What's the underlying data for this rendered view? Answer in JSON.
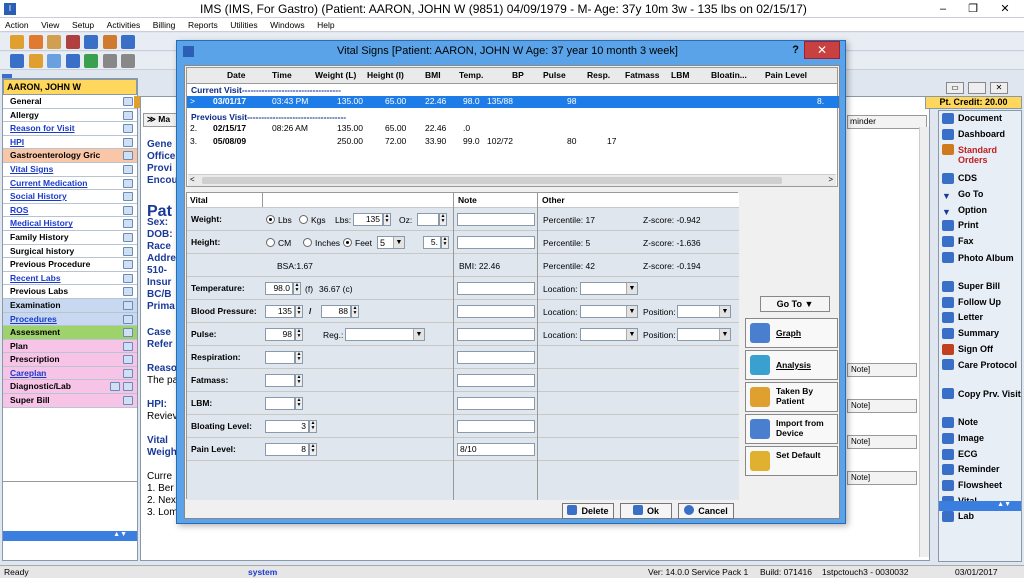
{
  "app": {
    "title": "IMS (IMS, For Gastro)    (Patient: AARON, JOHN W (9851) 04/09/1979 - M- Age: 37y 10m 3w - 135 lbs on 02/15/17)",
    "min": "–",
    "restore": "❐",
    "close": "✕"
  },
  "menu": [
    "Action",
    "View",
    "Setup",
    "Activities",
    "Billing",
    "Reports",
    "Utilities",
    "Windows",
    "Help"
  ],
  "patient_name": "AARON, JOHN W",
  "pt_credit": "Pt. Credit: 20.00",
  "left_nav": [
    {
      "label": "General",
      "bg": "#ffffff"
    },
    {
      "label": "Allergy",
      "bg": "#ffffff"
    },
    {
      "label": "Reason for Visit",
      "bg": "#ffffff",
      "fg": "#1a3acc"
    },
    {
      "label": "HPI",
      "bg": "#ffffff",
      "fg": "#1a3acc"
    },
    {
      "label": "Gastroenterology Gric",
      "bg": "#f9c7a8"
    },
    {
      "label": "Vital Signs",
      "bg": "#ffffff",
      "fg": "#1a3acc"
    },
    {
      "label": "Current Medication",
      "bg": "#ffffff",
      "fg": "#1a3acc"
    },
    {
      "label": "Social History",
      "bg": "#ffffff",
      "fg": "#1a3acc"
    },
    {
      "label": "ROS",
      "bg": "#ffffff",
      "fg": "#1a3acc"
    },
    {
      "label": "Medical History",
      "bg": "#ffffff",
      "fg": "#1a3acc"
    },
    {
      "label": "Family History",
      "bg": "#ffffff"
    },
    {
      "label": "Surgical history",
      "bg": "#ffffff"
    },
    {
      "label": "Previous Procedure",
      "bg": "#ffffff"
    },
    {
      "label": "Recent Labs",
      "bg": "#ffffff",
      "fg": "#1a3acc"
    },
    {
      "label": "Previous Labs",
      "bg": "#ffffff"
    },
    {
      "label": "Examination",
      "bg": "#c7d8f0"
    },
    {
      "label": "Procedures",
      "bg": "#c7d8f0",
      "fg": "#1a3acc"
    },
    {
      "label": "Assessment",
      "bg": "#9ed36b"
    },
    {
      "label": "Plan",
      "bg": "#f7c4e8"
    },
    {
      "label": "Prescription",
      "bg": "#f7c4e8"
    },
    {
      "label": "Careplan",
      "bg": "#f7c4e8",
      "fg": "#1a3acc"
    },
    {
      "label": "Diagnostic/Lab",
      "bg": "#f7c4e8"
    },
    {
      "label": "Super Bill",
      "bg": "#f7c4e8"
    }
  ],
  "mid": {
    "tab_label": "Ma",
    "lines": [
      "Gene",
      "Office",
      "Provi",
      "Encou",
      "Pat",
      "Sex:",
      "DOB:",
      "Race",
      "Addre",
      "510-",
      "Insur",
      "BC/B",
      "Prima",
      "Case",
      "Refer",
      "Reaso",
      "The pa",
      "HPI:",
      "Reviev",
      "Vital",
      "Weigh",
      "Curre",
      "1. Ber",
      "2. Nex",
      "3. Lom"
    ],
    "reminder": "minder",
    "note_label": "Note]"
  },
  "right_panel": [
    {
      "label": "Document",
      "c": "#3a6fc8"
    },
    {
      "label": "Dashboard",
      "c": "#3a6fc8"
    },
    {
      "label": "Standard Orders",
      "c": "#d07a20",
      "red": true
    },
    {
      "label": "CDS",
      "c": "#3a6fc8"
    },
    {
      "label": "Go To",
      "c": "#1a3a9a",
      "arrow": true
    },
    {
      "label": "Option",
      "c": "#1a3a9a",
      "arrow": true
    },
    {
      "label": "Print",
      "c": "#3a6fc8"
    },
    {
      "label": "Fax",
      "c": "#3a6fc8"
    },
    {
      "label": "Photo Album",
      "c": "#3a6fc8"
    },
    {
      "label": "Super Bill",
      "c": "#3a6fc8"
    },
    {
      "label": "Follow Up",
      "c": "#3a6fc8"
    },
    {
      "label": "Letter",
      "c": "#3a6fc8"
    },
    {
      "label": "Summary",
      "c": "#3a6fc8"
    },
    {
      "label": "Sign Off",
      "c": "#c04020"
    },
    {
      "label": "Care Protocol",
      "c": "#3a6fc8"
    },
    {
      "label": "Copy Prv. Visit",
      "c": "#3a6fc8"
    },
    {
      "label": "Note",
      "c": "#3a6fc8"
    },
    {
      "label": "Image",
      "c": "#3a6fc8"
    },
    {
      "label": "ECG",
      "c": "#3a6fc8"
    },
    {
      "label": "Reminder",
      "c": "#3a6fc8"
    },
    {
      "label": "Flowsheet",
      "c": "#3a6fc8"
    },
    {
      "label": "Vital",
      "c": "#3a6fc8"
    },
    {
      "label": "Lab",
      "c": "#3a6fc8"
    }
  ],
  "dialog": {
    "title": "Vital Signs  [Patient: AARON, JOHN W  Age: 37 year 10 month 3 week]",
    "help": "?",
    "close": "✕",
    "grid_headers": [
      "Date",
      "Time",
      "Weight (L)",
      "Height (I)",
      "BMI",
      "Temp.",
      "BP",
      "Pulse",
      "Resp.",
      "Fatmass",
      "LBM",
      "Bloatin...",
      "Pain Level"
    ],
    "current_label": "Current Visit-----------------------------------",
    "previous_label": "Previous Visit-----------------------------------",
    "current_rows": [
      {
        "idx": ">",
        "date": "03/01/17",
        "time": "03:43 PM",
        "weight": "135.00",
        "height": "65.00",
        "bmi": "22.46",
        "temp": "98.0",
        "bp": "135/88",
        "pulse": "98",
        "resp": "",
        "fat": "",
        "lbm": "",
        "bloat": "",
        "pain": "8."
      }
    ],
    "previous_rows": [
      {
        "idx": "2.",
        "date": "02/15/17",
        "time": "08:26 AM",
        "weight": "135.00",
        "height": "65.00",
        "bmi": "22.46",
        "temp": ".0",
        "bp": "",
        "pulse": "",
        "resp": "",
        "fat": "",
        "lbm": "",
        "bloat": "",
        "pain": ""
      },
      {
        "idx": "3.",
        "date": "05/08/09",
        "time": "",
        "weight": "250.00",
        "height": "72.00",
        "bmi": "33.90",
        "temp": "99.0",
        "bp": "102/72",
        "pulse": "80",
        "resp": "17",
        "fat": "",
        "lbm": "",
        "bloat": "",
        "pain": ""
      }
    ],
    "form_headers": {
      "vital": "Vital",
      "note": "Note",
      "other": "Other"
    },
    "weight": {
      "label": "Weight:",
      "lbs": "Lbs",
      "kgs": "Kgs",
      "lbs_label": "Lbs:",
      "lbs_value": "135",
      "oz_label": "Oz:",
      "oz_value": "",
      "percentile": "Percentile: 17",
      "zscore": "Z-score: -0.942"
    },
    "height": {
      "label": "Height:",
      "cm": "CM",
      "inches": "Inches",
      "feet": "Feet",
      "feet_value": "5",
      "inch_value": "5.",
      "percentile": "Percentile: 5",
      "zscore": "Z-score: -1.636"
    },
    "bsa": {
      "bsa": "BSA:1.67",
      "bmi": "BMI: 22.46",
      "percentile": "Percentile: 42",
      "zscore": "Z-score: -0.194"
    },
    "temperature": {
      "label": "Temperature:",
      "value": "98.0",
      "unit": "(f)",
      "celsius": "36.67 (c)",
      "location": "Location:"
    },
    "bp": {
      "label": "Blood Pressure:",
      "sys": "135",
      "dia": "88",
      "slash": "/",
      "location": "Location:",
      "position": "Position:"
    },
    "pulse": {
      "label": "Pulse:",
      "value": "98",
      "reg": "Reg.:",
      "location": "Location:",
      "position": "Position:"
    },
    "respiration": {
      "label": "Respiration:"
    },
    "fatmass": {
      "label": "Fatmass:"
    },
    "lbm": {
      "label": "LBM:"
    },
    "bloating": {
      "label": "Bloating Level:",
      "value": "3"
    },
    "pain": {
      "label": "Pain Level:",
      "value": "8",
      "note": "8/10"
    },
    "goto": "Go To ▼",
    "side_buttons": [
      {
        "label": "Graph",
        "c": "#4a7fd0"
      },
      {
        "label": "Analysis",
        "c": "#3aa0d0"
      },
      {
        "label": "Taken By Patient",
        "c": "#e0a030"
      },
      {
        "label": "Import from Device",
        "c": "#4a7fd0"
      },
      {
        "label": "Set Default",
        "c": "#e0b030"
      }
    ],
    "delete": "Delete",
    "ok": "Ok",
    "cancel": "Cancel"
  },
  "status": {
    "ready": "Ready",
    "user": "system",
    "ver": "Ver: 14.0.0 Service Pack 1",
    "build": "Build: 071416",
    "station": "1stpctouch3 - 0030032",
    "date": "03/01/2017"
  }
}
